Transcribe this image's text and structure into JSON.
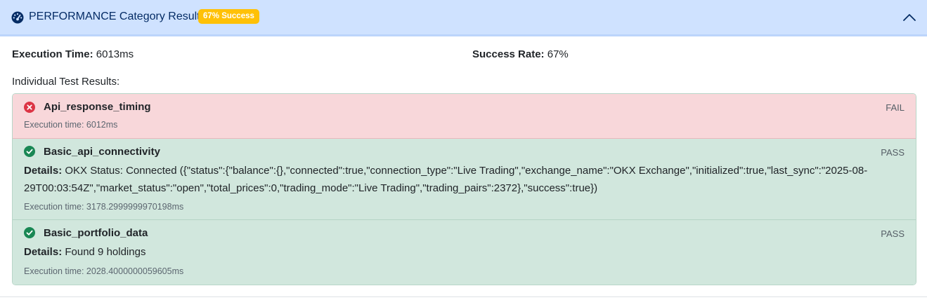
{
  "header": {
    "title": "PERFORMANCE Category Results",
    "badge": "67% Success",
    "icon": "gauge-icon",
    "collapse_icon": "chevron-up-icon",
    "colors": {
      "header_bg": "#cfe2ff",
      "badge_bg": "#ffc107"
    }
  },
  "summary": {
    "execution_time_label": "Execution Time:",
    "execution_time_value": "6013ms",
    "success_rate_label": "Success Rate:",
    "success_rate_value": "67%"
  },
  "results_heading": "Individual Test Results:",
  "tests": [
    {
      "name": "Api_response_timing",
      "status": "FAIL",
      "icon": "x-circle-icon",
      "details_label": "",
      "details": "",
      "execution_time": "Execution time: 6012ms",
      "color": "#dc3545"
    },
    {
      "name": "Basic_api_connectivity",
      "status": "PASS",
      "icon": "check-circle-icon",
      "details_label": "Details:",
      "details": "OKX Status: Connected ({\"status\":{\"balance\":{},\"connected\":true,\"connection_type\":\"Live Trading\",\"exchange_name\":\"OKX Exchange\",\"initialized\":true,\"last_sync\":\"2025-08-29T00:03:54Z\",\"market_status\":\"open\",\"total_prices\":0,\"trading_mode\":\"Live Trading\",\"trading_pairs\":2372},\"success\":true})",
      "execution_time": "Execution time: 3178.2999999970198ms",
      "color": "#198754"
    },
    {
      "name": "Basic_portfolio_data",
      "status": "PASS",
      "icon": "check-circle-icon",
      "details_label": "Details:",
      "details": "Found 9 holdings",
      "execution_time": "Execution time: 2028.4000000059605ms",
      "color": "#198754"
    }
  ]
}
